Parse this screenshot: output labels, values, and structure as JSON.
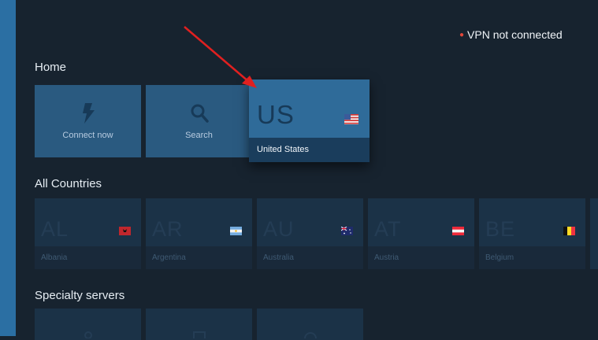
{
  "status": {
    "text": "VPN not connected",
    "dot_color": "#e0463a"
  },
  "home": {
    "title": "Home",
    "connect_label": "Connect now",
    "search_label": "Search",
    "focused": {
      "code": "US",
      "name": "United States"
    }
  },
  "countries": {
    "title": "All Countries",
    "items": [
      {
        "code": "AL",
        "name": "Albania"
      },
      {
        "code": "AR",
        "name": "Argentina"
      },
      {
        "code": "AU",
        "name": "Australia"
      },
      {
        "code": "AT",
        "name": "Austria"
      },
      {
        "code": "BE",
        "name": "Belgium"
      }
    ]
  },
  "specialty": {
    "title": "Specialty servers"
  },
  "colors": {
    "background": "#17232f",
    "side_strip": "#2b6fa3",
    "tile": "#2a5a80",
    "focus": "#2f6b99",
    "annotation_arrow": "#e02020"
  }
}
